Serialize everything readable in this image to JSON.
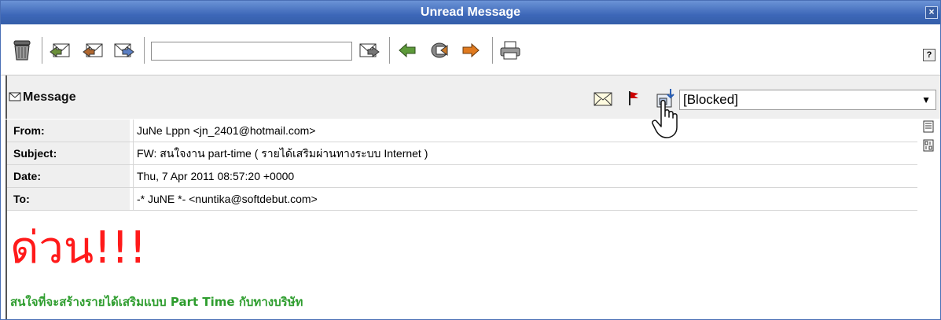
{
  "window": {
    "title": "Unread Message",
    "close_label": "×"
  },
  "toolbar": {
    "search_value": "",
    "help_label": "?"
  },
  "message": {
    "label": "Message",
    "status_value": "[Blocked]"
  },
  "headers": [
    {
      "label": "From:",
      "value": "JuNe Lppn <jn_2401@hotmail.com>"
    },
    {
      "label": "Subject:",
      "value": "FW: สนใจงาน part-time ( รายได้เสริมผ่านทางระบบ Internet )"
    },
    {
      "label": "Date:",
      "value": "Thu, 7 Apr 2011 08:57:20 +0000"
    },
    {
      "label": "To:",
      "value": "-* JuNE *- <nuntika@softdebut.com>"
    }
  ],
  "body": {
    "headline": "ด่วน!!!",
    "line1": "สนใจที่จะสร้างรายได้เสริมแบบ Part Time กับทางบริษัท"
  },
  "colors": {
    "titlebar": "#3d67b8",
    "headline": "#ff1a1a",
    "green_text": "#2e9d2e",
    "flag": "#cc0000"
  }
}
